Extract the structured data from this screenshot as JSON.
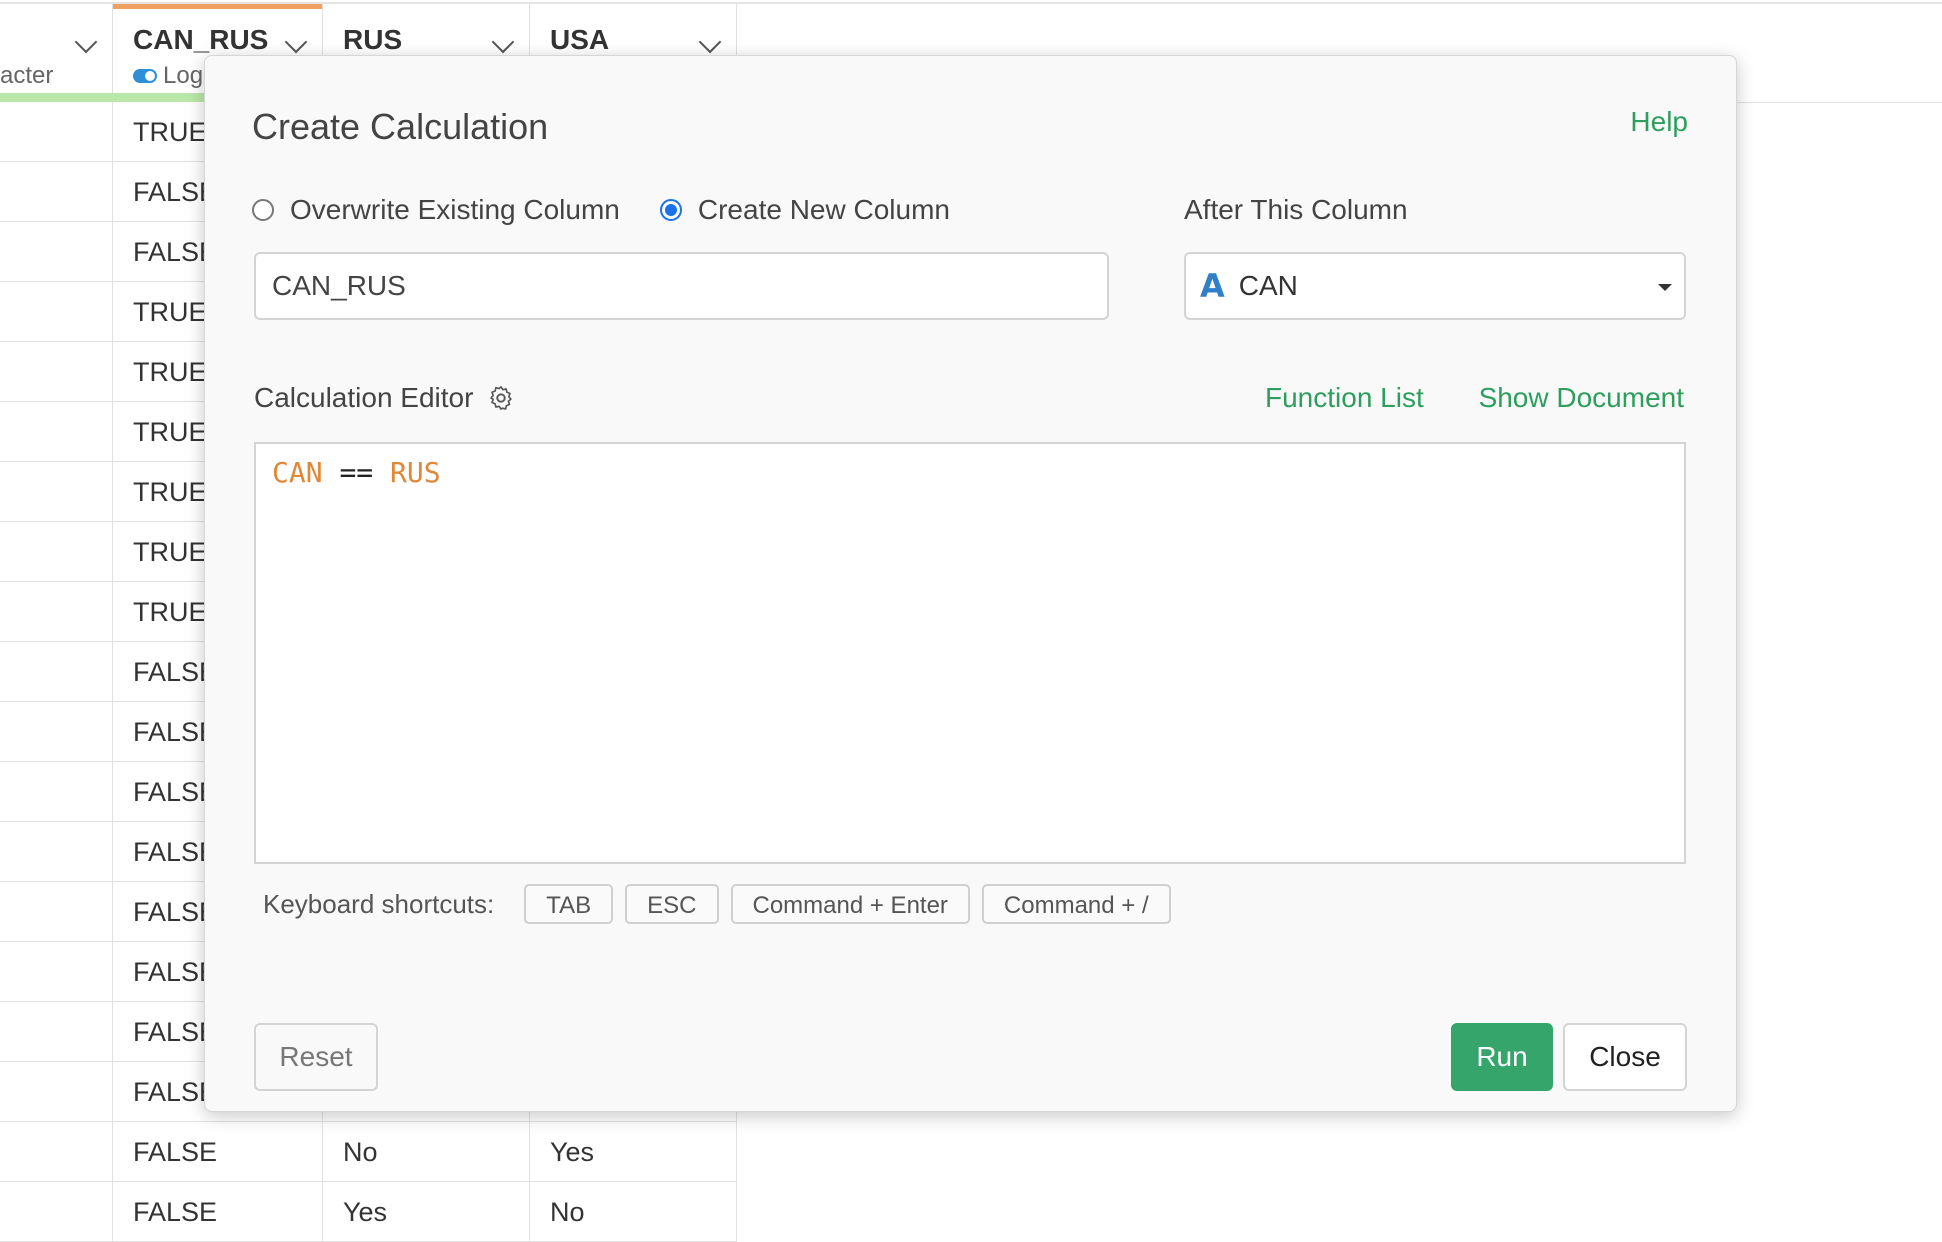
{
  "grid": {
    "columns": [
      {
        "name": "",
        "type": "acter"
      },
      {
        "name": "CAN_RUS",
        "type": "Log"
      },
      {
        "name": "RUS",
        "type": ""
      },
      {
        "name": "USA",
        "type": ""
      }
    ],
    "rows": [
      [
        "",
        "TRUE",
        "",
        ""
      ],
      [
        "",
        "FALSE",
        "",
        ""
      ],
      [
        "",
        "FALSE",
        "",
        ""
      ],
      [
        "",
        "TRUE",
        "",
        ""
      ],
      [
        "",
        "TRUE",
        "",
        ""
      ],
      [
        "",
        "TRUE",
        "",
        ""
      ],
      [
        "",
        "TRUE",
        "",
        ""
      ],
      [
        "",
        "TRUE",
        "",
        ""
      ],
      [
        "",
        "TRUE",
        "",
        ""
      ],
      [
        "",
        "FALSE",
        "",
        ""
      ],
      [
        "",
        "FALSE",
        "",
        ""
      ],
      [
        "",
        "FALSE",
        "",
        ""
      ],
      [
        "",
        "FALSE",
        "",
        ""
      ],
      [
        "",
        "FALSE",
        "",
        ""
      ],
      [
        "",
        "FALSE",
        "",
        ""
      ],
      [
        "",
        "FALSE",
        "",
        ""
      ],
      [
        "",
        "FALSE",
        "",
        ""
      ],
      [
        "",
        "FALSE",
        "No",
        "Yes"
      ],
      [
        "",
        "FALSE",
        "Yes",
        "No"
      ]
    ]
  },
  "dialog": {
    "title": "Create Calculation",
    "help": "Help",
    "overwrite_label": "Overwrite Existing Column",
    "create_label": "Create New Column",
    "after_label": "After This Column",
    "column_name_value": "CAN_RUS",
    "after_column": "CAN",
    "after_column_type_icon": "A",
    "editor_label": "Calculation Editor",
    "function_list": "Function List",
    "show_document": "Show Document",
    "expression": {
      "left": "CAN",
      "op": "==",
      "right": "RUS"
    },
    "shortcuts_label": "Keyboard shortcuts:",
    "shortcuts": [
      "TAB",
      "ESC",
      "Command + Enter",
      "Command + /"
    ],
    "reset": "Reset",
    "run": "Run",
    "close": "Close"
  },
  "colors": {
    "accent_green": "#35a56c",
    "link_green": "#2e9e5e",
    "radio_blue": "#1a73e8",
    "token_orange": "#e0883a"
  }
}
